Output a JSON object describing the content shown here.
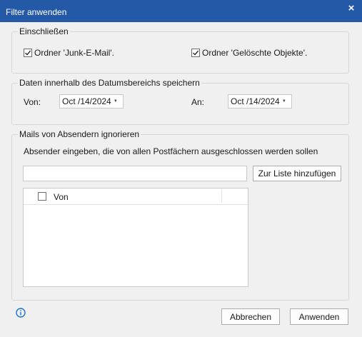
{
  "window": {
    "title": "Filter anwenden",
    "close_glyph": "×",
    "title_bar_color": "#2459a8"
  },
  "include": {
    "legend": "Einschließen",
    "junk_label": "Ordner 'Junk-E-Mail'.",
    "junk_checked": true,
    "deleted_label": "Ordner 'Gelöschte Objekte'.",
    "deleted_checked": true
  },
  "date_range": {
    "legend": "Daten innerhalb des Datumsbereichs speichern",
    "from_label": "Von:",
    "from_value": "Oct /14/2024",
    "to_label": "An:",
    "to_value": "Oct /14/2024",
    "dropdown_glyph": "▼"
  },
  "ignore_senders": {
    "legend": "Mails von Absendern ignorieren",
    "instruction": "Absender eingeben, die von allen Postfächern ausgeschlossen werden sollen",
    "sender_input_value": "",
    "add_button": "Zur Liste hinzufügen",
    "list_header": "Von",
    "list_header_checked": false,
    "rows": []
  },
  "footer": {
    "info_icon": "info-icon",
    "cancel_button": "Abbrechen",
    "apply_button": "Anwenden"
  },
  "colors": {
    "accent": "#2459a8",
    "info": "#1a73d9"
  }
}
